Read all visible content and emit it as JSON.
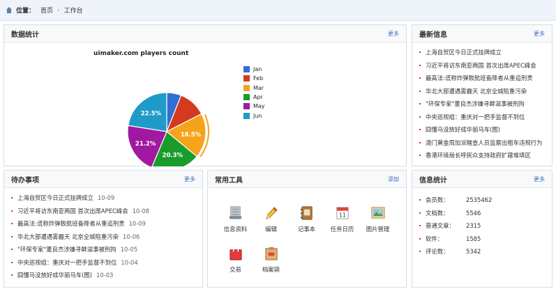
{
  "breadcrumb": {
    "label": "位置：",
    "items": [
      "首页",
      "工作台"
    ],
    "separator": "›"
  },
  "stats": {
    "title": "数据统计",
    "more": "更多"
  },
  "chart_data": {
    "type": "pie",
    "title": "uimaker.com players count",
    "categories": [
      "Jan",
      "Feb",
      "Mar",
      "Apr",
      "May",
      "Jun"
    ],
    "values": [
      6.0,
      11.5,
      18.5,
      20.3,
      21.2,
      22.5
    ],
    "labels": [
      "",
      "",
      "18.5%",
      "20.3%",
      "21.2%",
      "22.5%"
    ],
    "colors": [
      "#2f6fd6",
      "#d53a1e",
      "#f5a31a",
      "#1a9c2a",
      "#a019a0",
      "#1f9bc9"
    ],
    "legend": "right",
    "exploded": "Mar"
  },
  "news": {
    "title": "最新信息",
    "more": "更多",
    "items": [
      "上海自贸区今日正式挂牌成立",
      "习近平将访东南亚两国 首次出席APEC峰会",
      "最高法:谎称炸弹致航班备降者从重追刑责",
      "华北大部遭遇雾霾天 北京全城陷重污染",
      "\"环保专家\"董良杰涉嫌寻衅滋事被刑拘",
      "中央巡视组：重庆对一把手监督不到位",
      "囧懂马没放好成华丽马车(图)",
      "澳门黄金周加派赌查人员监察出租车违规行为",
      "香港环境局长呼民众支持政府扩建堆填区"
    ]
  },
  "todo": {
    "title": "待办事项",
    "more": "更多",
    "items": [
      {
        "text": "上海自贸区今日正式挂牌成立",
        "date": "10-09"
      },
      {
        "text": "习近平将访东南亚两国 首次出席APEC峰会",
        "date": "10-08"
      },
      {
        "text": "最高法:谎称炸弹致航班备降者从重追刑责",
        "date": "10-09"
      },
      {
        "text": "华北大部遭遇雾霾天 北京全城陷重污染",
        "date": "10-06"
      },
      {
        "text": "\"环保专家\"董良杰涉嫌寻衅滋事被刑拘",
        "date": "10-05"
      },
      {
        "text": "中央巡视组：重庆对一把手监督不到位",
        "date": "10-04"
      },
      {
        "text": "囧懂马没放好成华丽马车(图)",
        "date": "10-03"
      }
    ]
  },
  "tools": {
    "title": "常用工具",
    "add": "添加",
    "items": [
      {
        "label": "信息资料",
        "icon": "document-icon"
      },
      {
        "label": "编辑",
        "icon": "pencil-icon"
      },
      {
        "label": "记事本",
        "icon": "notebook-icon"
      },
      {
        "label": "任务日历",
        "icon": "calendar-icon"
      },
      {
        "label": "图片管理",
        "icon": "picture-icon"
      },
      {
        "label": "交易",
        "icon": "shopping-bag-icon"
      },
      {
        "label": "档案袋",
        "icon": "archive-bag-icon"
      }
    ]
  },
  "info": {
    "title": "信息统计",
    "more": "更多",
    "items": [
      {
        "k": "会员数：",
        "v": "2535462"
      },
      {
        "k": "文档数：",
        "v": "5546"
      },
      {
        "k": "普通文章：",
        "v": "2315"
      },
      {
        "k": "软件：",
        "v": "1585"
      },
      {
        "k": "评论数：",
        "v": "5342"
      }
    ]
  }
}
